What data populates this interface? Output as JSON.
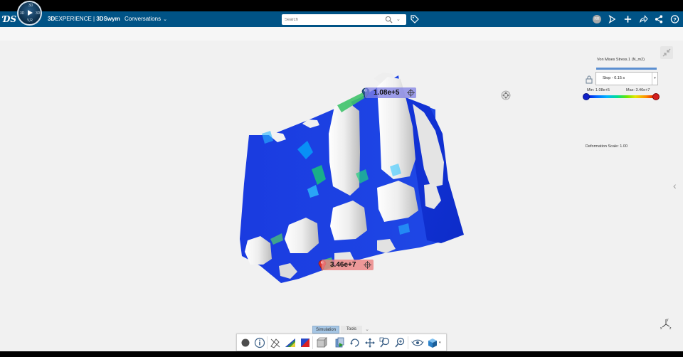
{
  "app": {
    "brand_prefix": "3D",
    "brand_name": "EXPERIENCE",
    "separator": " | ",
    "platform": "3DSwym",
    "space": "Conversations"
  },
  "compass": {
    "top_label": "3D",
    "left_label": "3D",
    "right_label": "3D",
    "bottom_label": "V,R"
  },
  "search": {
    "placeholder": "Search"
  },
  "user": {
    "initials": "RR"
  },
  "probes": {
    "min_value": "1.08e+5",
    "max_value": "3.46e+7"
  },
  "legend": {
    "title": "Von Mises Stress.1 (N_m2)",
    "step_value": "Stop - 0.15 s",
    "min_label": "Min: 1.08e+5",
    "max_label": "Max: 3.46e+7",
    "deformation_scale": "Deformation Scale: 1.00"
  },
  "tabs": {
    "simulation": "Simulation",
    "tools": "Tools"
  },
  "colors": {
    "topbar": "#005386",
    "stress_low": "#0000d4",
    "stress_high": "#e00000",
    "probe_min": "#8080e4",
    "probe_max": "#ec8282"
  },
  "icons": [
    "search-icon",
    "tag-icon",
    "share-icon",
    "plus-icon",
    "forward-icon",
    "network-icon",
    "help-icon",
    "lock-icon",
    "move-icon",
    "collapse-icon",
    "axis-icon"
  ]
}
